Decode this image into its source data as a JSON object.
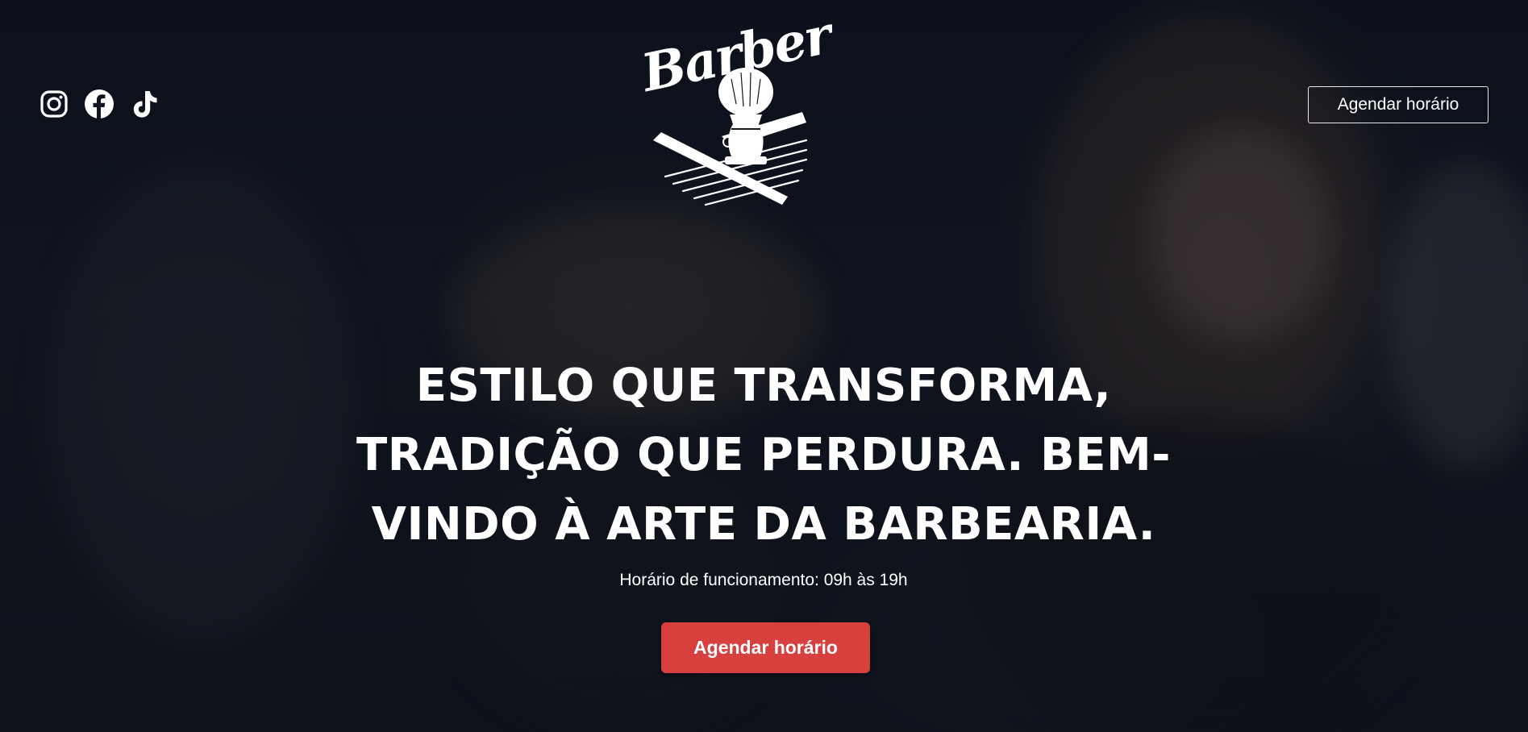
{
  "header": {
    "social_icons": [
      "instagram-icon",
      "facebook-icon",
      "tiktok-icon"
    ],
    "logo_text": "Barber",
    "schedule_button_label": "Agendar horário"
  },
  "hero": {
    "headline": "ESTILO QUE TRANSFORMA, TRADIÇÃO QUE PERDURA. BEM-VINDO À ARTE DA BARBEARIA.",
    "hours": "Horário de funcionamento: 09h às 19h",
    "cta_label": "Agendar horário"
  },
  "colors": {
    "accent": "#d8403f",
    "background": "#0e1520",
    "text": "#ffffff"
  }
}
